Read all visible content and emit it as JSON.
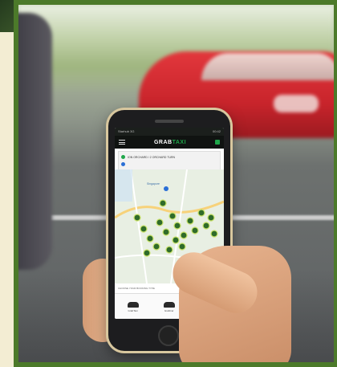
{
  "app": {
    "title_main": "GRAB",
    "title_accent": "TAXI",
    "status_left": "Starhub 3G",
    "status_time": "00:42"
  },
  "pickup": {
    "line": "ION ORCHARD / 2 ORCHARD TURN"
  },
  "map": {
    "label": "Singapore"
  },
  "services": {
    "notice": "CHOOSE YOUR BOOKING TYPE",
    "items": [
      {
        "label": "GrabTaxi"
      },
      {
        "label": "GrabCar"
      },
      {
        "label": "GrabShare"
      }
    ]
  },
  "colors": {
    "frame": "#4c7a2a",
    "brand_green": "#1fa74a",
    "taxi_red": "#c8242b"
  }
}
